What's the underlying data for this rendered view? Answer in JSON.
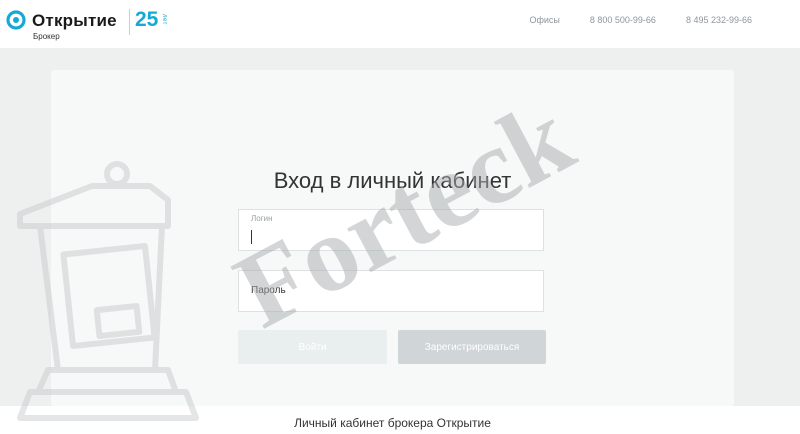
{
  "header": {
    "brand": "Открытие",
    "brand_sub": "Брокер",
    "anniversary_number": "25",
    "anniversary_word": "лет",
    "nav": [
      "Офисы",
      "8 800 500-99-66",
      "8 495 232-99-66"
    ],
    "brand_color": "#16a9d8"
  },
  "login_form": {
    "title": "Вход в личный кабинет",
    "login_label": "Логин",
    "login_value": "",
    "password_label": "Пароль",
    "password_value": "",
    "login_button": "Войти",
    "register_button": "Зарегистрироваться"
  },
  "footer": {
    "text": "Личный кабинет брокера Открытие"
  },
  "watermark": {
    "text": "Forteck",
    "icon": "podium-icon"
  }
}
